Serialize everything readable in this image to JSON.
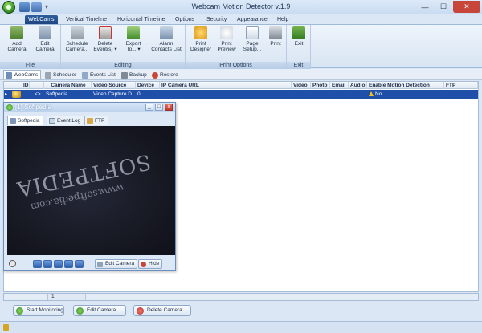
{
  "window": {
    "title": "Webcam Motion Detector v.1.9",
    "min_glyph": "—",
    "max_glyph": "☐",
    "close_glyph": "✕",
    "qat_more_glyph": "▾"
  },
  "ribbon_tabs": [
    "WebCams",
    "Vertical Timeline",
    "Horizontal Timeline",
    "Options",
    "Security",
    "Appearance",
    "Help"
  ],
  "ribbon": {
    "groups": {
      "file": "File",
      "editing": "Editing",
      "print_options": "Print Options",
      "exit": "Exit"
    },
    "buttons": {
      "add_camera": "Add Camera",
      "edit_camera": "Edit Camera",
      "schedule_camera": "Schedule Camera...",
      "delete_events": "Delete Event(s) ▾",
      "export_to": "Export To... ▾",
      "alarm_contacts": "Alarm Contacts List",
      "print_designer": "Print Designer",
      "print_preview": "Print Preview",
      "page_setup": "Page Setup...",
      "print": "Print",
      "exit": "Exit"
    }
  },
  "subtabs": [
    "WebCams",
    "Scheduler",
    "Events List",
    "Backup",
    "Restore"
  ],
  "grid": {
    "columns": [
      "ID",
      "Camera Name",
      "Video Source",
      "Device",
      "IP Camera URL",
      "Video",
      "Photo",
      "Email",
      "Audio",
      "Enable Motion Detection",
      "FTP"
    ],
    "row": {
      "indicator": "▸",
      "id": "<>",
      "camera_name": "Softpedia",
      "video_source": "Video Capture D...",
      "device": "0",
      "enable_motion_detection": "No"
    },
    "footer_count": "1"
  },
  "bottom_buttons": {
    "start_monitoring": "Start Monitoring",
    "edit_camera": "Edit Camera",
    "delete_camera": "Delete Camera"
  },
  "camera_window": {
    "title": "[1] Softpedia",
    "tabs": [
      "Softpedia",
      "Event Log",
      "FTP"
    ],
    "watermark_logo": "SOFTPEDIA",
    "watermark_url": "www.softpedia.com",
    "edit_camera": "Edit Camera",
    "hide": "Hide",
    "min_glyph": "_",
    "max_glyph": "□",
    "close_glyph": "x"
  },
  "colors": {
    "accent": "#1f4fa8",
    "title_bar": "#c9dcf2",
    "close": "#c8453a",
    "warning": "#f3c21b"
  }
}
